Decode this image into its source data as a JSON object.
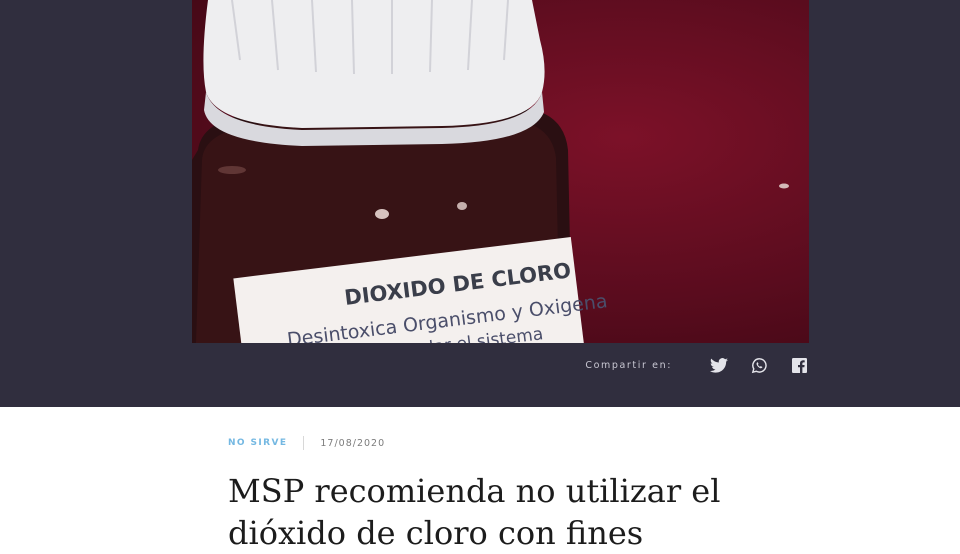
{
  "article": {
    "photo": {
      "label_title": "DIOXIDO DE CLORO",
      "label_line1": "Desintoxica Organismo y Oxigena",
      "label_line2": "lar el sistema"
    },
    "share": {
      "label": "Compartir en:",
      "icons": [
        "twitter-icon",
        "whatsapp-icon",
        "facebook-icon"
      ]
    },
    "category": "NO SIRVE",
    "date": "17/08/2020",
    "title": "MSP recomienda no utilizar el dióxido de cloro con fines"
  },
  "colors": {
    "hero_background": "#302e3e",
    "category_accent": "#74b8e2",
    "title_text": "#1c1c1c"
  }
}
